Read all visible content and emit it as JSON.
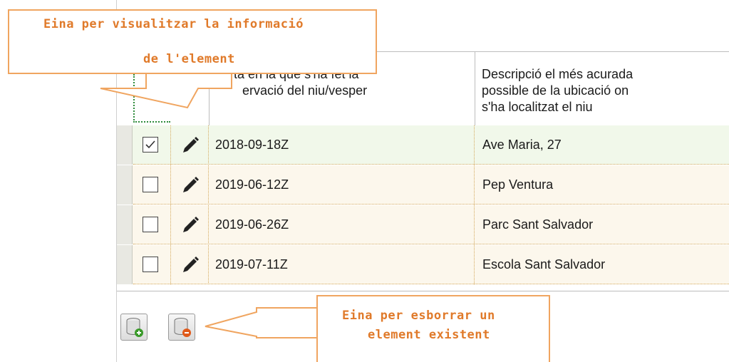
{
  "table": {
    "headers": {
      "date_col": "Data en la que s'ha fet la observació del niu/vesper",
      "date_col_visible_line1": "ta en la que s'ha fet la",
      "date_col_visible_line2": "ervació del niu/vesper",
      "location_col_line1": "Descripció el més acurada",
      "location_col_line2": "possible de la ubicació on",
      "location_col_line3": "s'ha localitzat el niu"
    },
    "rows": [
      {
        "checked": true,
        "date": "2018-09-18Z",
        "location": "Ave Maria, 27"
      },
      {
        "checked": false,
        "date": "2019-06-12Z",
        "location": "Pep Ventura"
      },
      {
        "checked": false,
        "date": "2019-06-26Z",
        "location": "Parc Sant Salvador"
      },
      {
        "checked": false,
        "date": "2019-07-11Z",
        "location": "Escola Sant Salvador"
      }
    ]
  },
  "toolbar": {
    "add_icon": "database-add-icon",
    "remove_icon": "database-remove-icon"
  },
  "callouts": {
    "info_line1": "Eina per visualitzar la informació",
    "info_line2": "de l'element",
    "delete_line1": "Eina per esborrar un",
    "delete_line2": "element existent"
  },
  "colors": {
    "callout_border": "#f0a560",
    "callout_text": "#e07a2a",
    "selected_row_bg": "#f1f8ea",
    "row_bg": "#fcf7ec"
  }
}
